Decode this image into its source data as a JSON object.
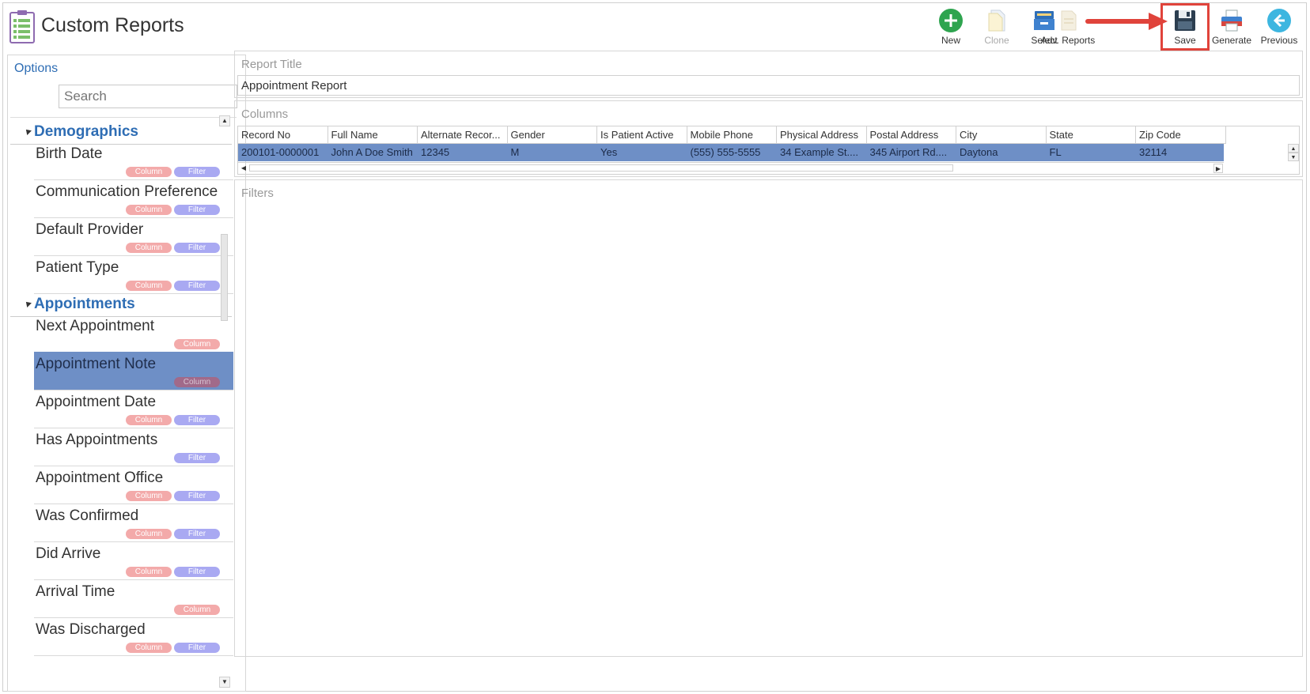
{
  "app": {
    "title": "Custom Reports"
  },
  "toolbar": {
    "new": "New",
    "clone": "Clone",
    "select": "Select",
    "adv_reports": "Adv. Reports",
    "save": "Save",
    "generate": "Generate",
    "previous": "Previous"
  },
  "options": {
    "label": "Options",
    "search_placeholder": "Search",
    "tag_column": "Column",
    "tag_filter": "Filter",
    "groups": [
      {
        "title": "Demographics",
        "items": [
          {
            "name": "Birth Date",
            "column": true,
            "filter": true
          },
          {
            "name": "Communication Preference",
            "column": true,
            "filter": true
          },
          {
            "name": "Default Provider",
            "column": true,
            "filter": true
          },
          {
            "name": "Patient Type",
            "column": true,
            "filter": true
          }
        ]
      },
      {
        "title": "Appointments",
        "items": [
          {
            "name": "Next Appointment",
            "column": true,
            "filter": false
          },
          {
            "name": "Appointment Note",
            "column": true,
            "filter": false,
            "selected": true
          },
          {
            "name": "Appointment Date",
            "column": true,
            "filter": true
          },
          {
            "name": "Has Appointments",
            "column": false,
            "filter": true
          },
          {
            "name": "Appointment Office",
            "column": true,
            "filter": true
          },
          {
            "name": "Was Confirmed",
            "column": true,
            "filter": true
          },
          {
            "name": "Did Arrive",
            "column": true,
            "filter": true
          },
          {
            "name": "Arrival Time",
            "column": true,
            "filter": false
          },
          {
            "name": "Was Discharged",
            "column": true,
            "filter": true
          }
        ]
      }
    ]
  },
  "report": {
    "title_label": "Report Title",
    "title_value": "Appointment Report",
    "columns_label": "Columns",
    "filters_label": "Filters",
    "columns": [
      "Record No",
      "Full Name",
      "Alternate Recor...",
      "Gender",
      "Is Patient Active",
      "Mobile Phone",
      "Physical Address",
      "Postal Address",
      "City",
      "State",
      "Zip Code"
    ],
    "rows": [
      [
        "200101-0000001",
        "John A Doe Smith",
        "12345",
        "M",
        "Yes",
        "(555) 555-5555",
        "34 Example St....",
        "345 Airport Rd....",
        "Daytona",
        "FL",
        "32114"
      ]
    ]
  },
  "colors": {
    "accent": "#2e6db4",
    "selection": "#6e8fc6",
    "column_tag": "#f3aaaa",
    "filter_tag": "#a9a9f2",
    "highlight": "#e0433b"
  }
}
